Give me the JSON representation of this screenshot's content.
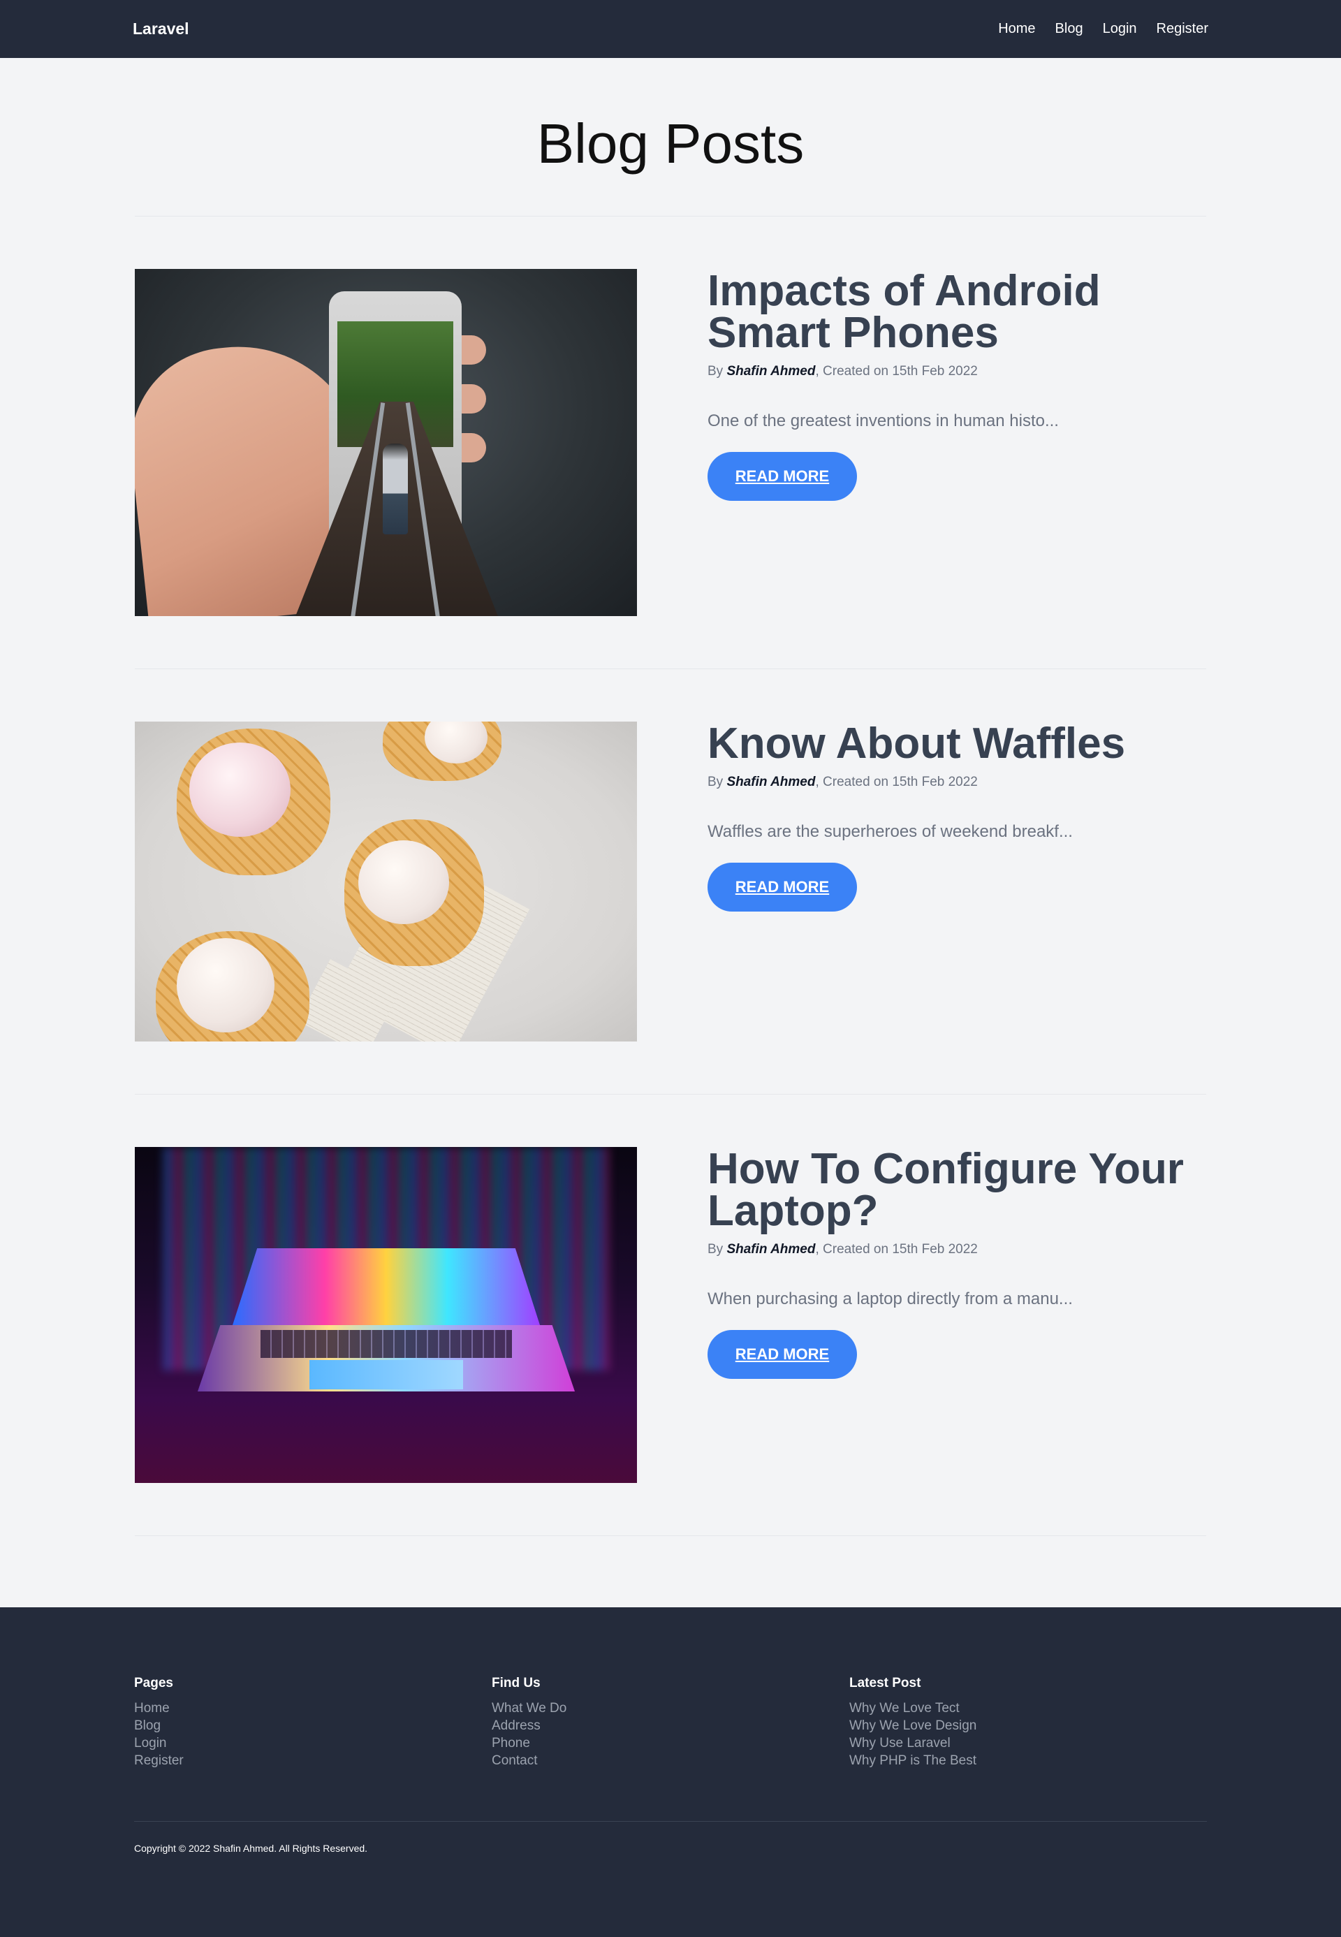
{
  "nav": {
    "brand": "Laravel",
    "links": [
      "Home",
      "Blog",
      "Login",
      "Register"
    ]
  },
  "page": {
    "title": "Blog Posts"
  },
  "posts": [
    {
      "title": "Impacts of Android Smart Phones",
      "by": "By ",
      "author": "Shafin Ahmed",
      "created": ", Created on 15th Feb 2022",
      "excerpt": "One of the greatest inventions in human histo...",
      "button": "Read More"
    },
    {
      "title": "Know About Waffles",
      "by": "By ",
      "author": "Shafin Ahmed",
      "created": ", Created on 15th Feb 2022",
      "excerpt": "Waffles are the superheroes of weekend breakf...",
      "button": "Read More"
    },
    {
      "title": "How To Configure Your Laptop?",
      "by": "By ",
      "author": "Shafin Ahmed",
      "created": ", Created on 15th Feb 2022",
      "excerpt": "When purchasing a laptop directly from a manu...",
      "button": "Read More"
    }
  ],
  "footer": {
    "columns": [
      {
        "heading": "Pages",
        "links": [
          "Home",
          "Blog",
          "Login",
          "Register"
        ]
      },
      {
        "heading": "Find Us",
        "links": [
          "What We Do",
          "Address",
          "Phone",
          "Contact"
        ]
      },
      {
        "heading": "Latest Post",
        "links": [
          "Why We Love Tect",
          "Why We Love Design",
          "Why Use Laravel",
          "Why PHP is The Best"
        ]
      }
    ],
    "copyright": "Copyright © 2022 Shafin Ahmed. All Rights Reserved."
  },
  "colors": {
    "navbar": "#242b3b",
    "background": "#f3f4f6",
    "accent": "#3b82f6",
    "title": "#374151"
  }
}
